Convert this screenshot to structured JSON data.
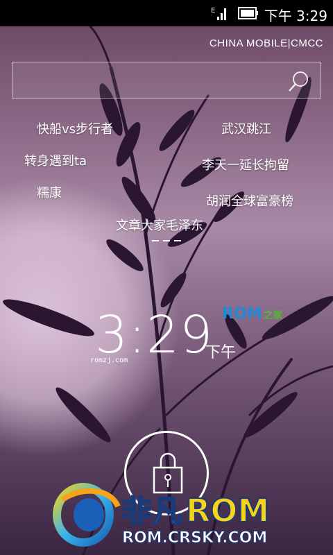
{
  "status_bar": {
    "signal_label": "E",
    "time": "下午 3:29",
    "icons": [
      "signal-icon",
      "battery-icon"
    ]
  },
  "carrier": "CHINA  MOBILE|CMCC",
  "search": {
    "icon": "search-icon"
  },
  "hot_words": [
    "快船vs步行者",
    "武汉跳江",
    "转身遇到ta",
    "李天一延长拘留",
    "糯康",
    "胡润全球富豪榜",
    "文章大家毛泽东"
  ],
  "clock": {
    "time": "3:29",
    "ampm": "下午"
  },
  "watermark": {
    "logo_text": "ROM",
    "logo_suffix": "之家",
    "url": "romzj.com"
  },
  "unlock": {
    "icon": "lock-icon"
  },
  "brand": {
    "name_cn": "非凡",
    "name_rom": "ROM",
    "url": "ROM.CRSKY.COM"
  },
  "colors": {
    "accent_blue": "#1f8ad8",
    "accent_green": "#52b833",
    "brand_yellow": "#f6d31a"
  }
}
